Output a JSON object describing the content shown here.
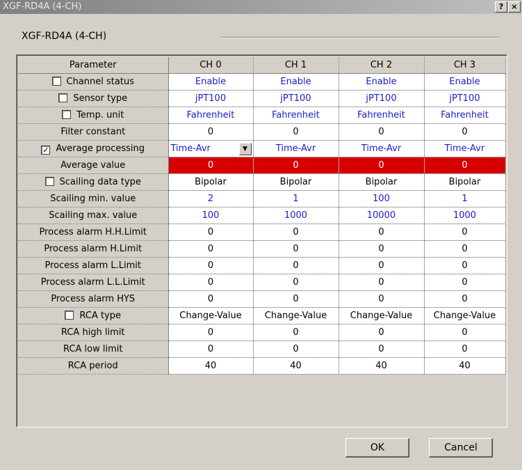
{
  "window": {
    "title": "XGF-RD4A (4-CH)",
    "help_label": "?",
    "close_label": "×"
  },
  "group": {
    "label": "XGF-RD4A (4-CH)"
  },
  "table": {
    "headers": [
      "Parameter",
      "CH 0",
      "CH 1",
      "CH 2",
      "CH 3"
    ],
    "rows": [
      {
        "label": "Channel status",
        "checkbox": true,
        "checked": false,
        "blue": true,
        "values": [
          "Enable",
          "Enable",
          "Enable",
          "Enable"
        ]
      },
      {
        "label": "Sensor type",
        "checkbox": true,
        "checked": false,
        "blue": true,
        "values": [
          "jPT100",
          "jPT100",
          "jPT100",
          "jPT100"
        ]
      },
      {
        "label": "Temp. unit",
        "checkbox": true,
        "checked": false,
        "blue": true,
        "values": [
          "Fahrenheit",
          "Fahrenheit",
          "Fahrenheit",
          "Fahrenheit"
        ]
      },
      {
        "label": "Filter constant",
        "checkbox": false,
        "blue": false,
        "values": [
          "0",
          "0",
          "0",
          "0"
        ]
      },
      {
        "label": "Average processing",
        "checkbox": true,
        "checked": true,
        "blue": true,
        "combo_first": true,
        "values": [
          "Time-Avr",
          "Time-Avr",
          "Time-Avr",
          "Time-Avr"
        ]
      },
      {
        "label": "Average value",
        "checkbox": false,
        "highlight": true,
        "values": [
          "0",
          "0",
          "0",
          "0"
        ]
      },
      {
        "label": "Scailing data type",
        "checkbox": true,
        "checked": false,
        "blue": false,
        "values": [
          "Bipolar",
          "Bipolar",
          "Bipolar",
          "Bipolar"
        ]
      },
      {
        "label": "Scailing min. value",
        "checkbox": false,
        "blue": true,
        "values": [
          "2",
          "1",
          "100",
          "1"
        ]
      },
      {
        "label": "Scailing max. value",
        "checkbox": false,
        "blue": true,
        "values": [
          "100",
          "1000",
          "10000",
          "1000"
        ]
      },
      {
        "label": "Process alarm H.H.Limit",
        "checkbox": false,
        "blue": false,
        "values": [
          "0",
          "0",
          "0",
          "0"
        ]
      },
      {
        "label": "Process alarm H.Limit",
        "checkbox": false,
        "blue": false,
        "values": [
          "0",
          "0",
          "0",
          "0"
        ]
      },
      {
        "label": "Process alarm L.Limit",
        "checkbox": false,
        "blue": false,
        "values": [
          "0",
          "0",
          "0",
          "0"
        ]
      },
      {
        "label": "Process alarm L.L.Limit",
        "checkbox": false,
        "blue": false,
        "values": [
          "0",
          "0",
          "0",
          "0"
        ]
      },
      {
        "label": "Process alarm HYS",
        "checkbox": false,
        "blue": false,
        "values": [
          "0",
          "0",
          "0",
          "0"
        ]
      },
      {
        "label": "RCA type",
        "checkbox": true,
        "checked": false,
        "blue": false,
        "values": [
          "Change-Value",
          "Change-Value",
          "Change-Value",
          "Change-Value"
        ]
      },
      {
        "label": "RCA high limit",
        "checkbox": false,
        "blue": false,
        "values": [
          "0",
          "0",
          "0",
          "0"
        ]
      },
      {
        "label": "RCA low limit",
        "checkbox": false,
        "blue": false,
        "values": [
          "0",
          "0",
          "0",
          "0"
        ]
      },
      {
        "label": "RCA period",
        "checkbox": false,
        "blue": false,
        "values": [
          "40",
          "40",
          "40",
          "40"
        ]
      }
    ]
  },
  "buttons": {
    "ok": "OK",
    "cancel": "Cancel"
  },
  "colors": {
    "value_blue": "#1c1cc8",
    "highlight_red": "#d70000",
    "dialog_bg": "#d4d0c8"
  }
}
